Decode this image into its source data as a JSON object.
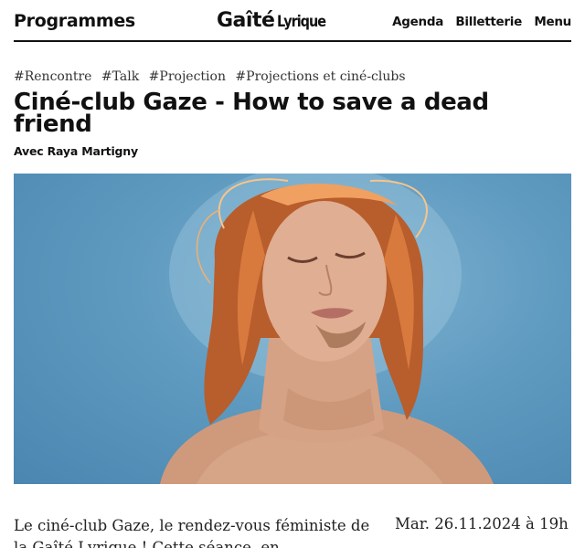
{
  "header": {
    "programmes_label": "Programmes",
    "logo_main": "Gaîté",
    "logo_sub": "Lyrique",
    "nav": [
      {
        "label": "Agenda"
      },
      {
        "label": "Billetterie"
      },
      {
        "label": "Menu"
      }
    ]
  },
  "event": {
    "tags": [
      "#Rencontre",
      "#Talk",
      "#Projection",
      "#Projections et ciné-clubs"
    ],
    "title": "Ciné-club Gaze - How to save a dead friend",
    "subtitle": "Avec Raya Martigny",
    "intro": "Le ciné-club Gaze, le rendez-vous féministe de la Gaîté Lyrique ! Cette séance, en",
    "date": "Mar. 26.11.2024 à 19h"
  },
  "colors": {
    "text": "#111111",
    "hero_background": "#5f9ac0",
    "hair": "#c86a35",
    "skin": "#d9a486"
  }
}
